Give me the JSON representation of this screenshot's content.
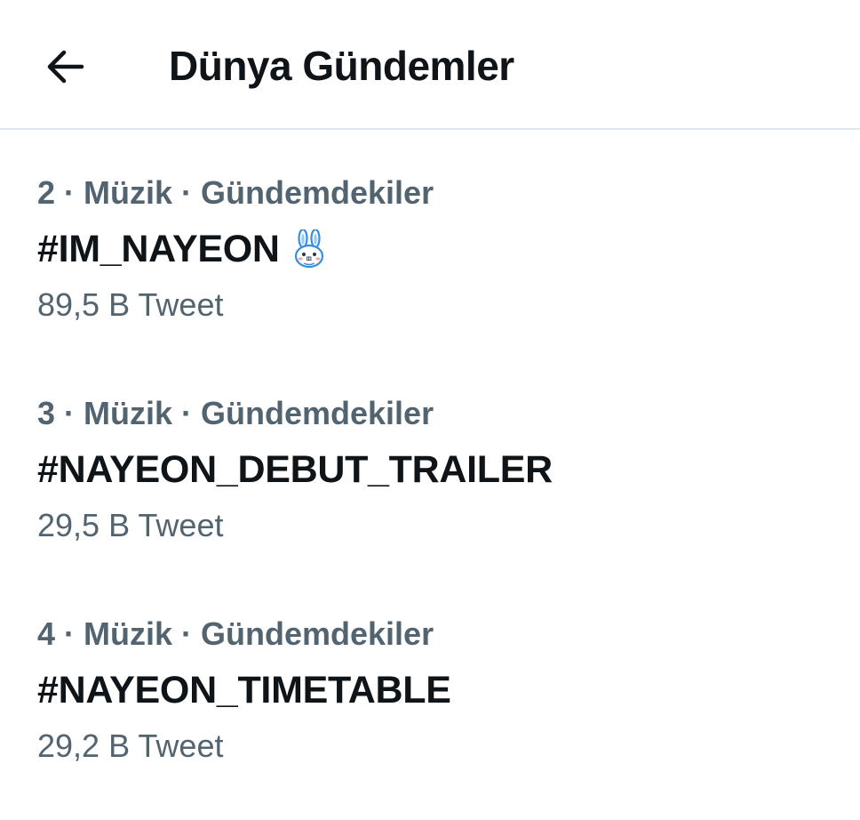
{
  "header": {
    "title": "Dünya Gündemler",
    "back_icon": "arrow-left-icon"
  },
  "trends": [
    {
      "meta": "2 · Müzik · Gündemdekiler",
      "name": "#IM_NAYEON",
      "hashflag_icon": "bunny-icon",
      "count": "89,5 B Tweet"
    },
    {
      "meta": "3 · Müzik · Gündemdekiler",
      "name": "#NAYEON_DEBUT_TRAILER",
      "count": "29,5 B Tweet"
    },
    {
      "meta": "4 · Müzik · Gündemdekiler",
      "name": "#NAYEON_TIMETABLE",
      "count": "29,2 B Tweet"
    }
  ],
  "colors": {
    "text_primary": "#0f1419",
    "text_secondary": "#536471",
    "divider": "#e1e8ed",
    "background": "#ffffff"
  }
}
